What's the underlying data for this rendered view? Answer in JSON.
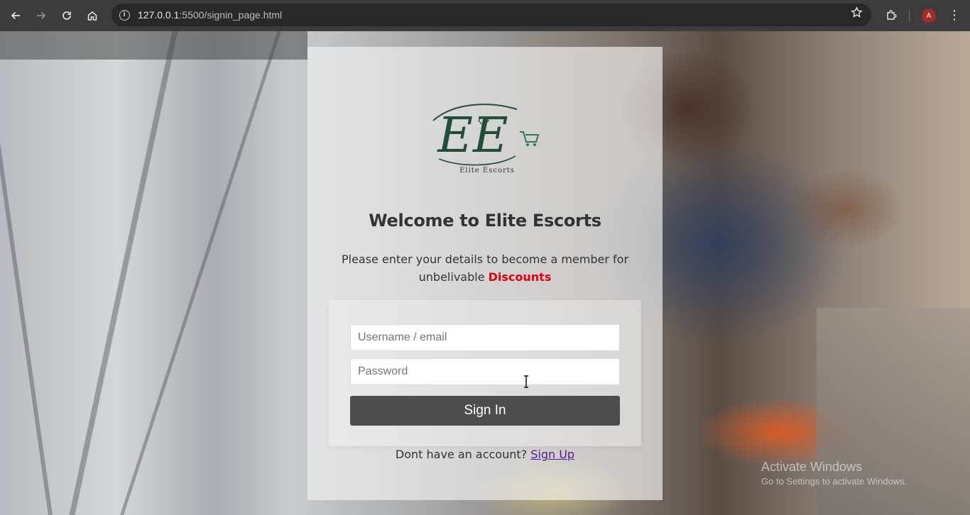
{
  "browser": {
    "url_host": "127.0.0.1",
    "url_path": ":5500/signin_page.html",
    "avatar_letter": "A",
    "icons": [
      "back-arrow-icon",
      "forward-arrow-icon",
      "reload-icon",
      "home-icon",
      "site-info-icon",
      "bookmark-star-icon",
      "extensions-icon",
      "more-menu-icon"
    ]
  },
  "logo": {
    "initials": "EE",
    "caption": "Elite Escorts"
  },
  "heading": "Welcome to Elite Escorts",
  "subtitle": {
    "line1": "Please enter your details to become a member for",
    "line2_prefix": "unbelivable ",
    "line2_accent": "Discounts"
  },
  "form": {
    "username_placeholder": "Username / email",
    "password_placeholder": "Password",
    "signin_label": "Sign In"
  },
  "footer": {
    "prompt": "Dont have an account? ",
    "signup_label": "Sign Up"
  },
  "watermark": {
    "line1": "Activate Windows",
    "line2": "Go to Settings to activate Windows."
  },
  "colors": {
    "accent": "#e0000f",
    "button": "#4d4d4d",
    "logo_green": "#1f4f36",
    "link": "#551a8b"
  }
}
